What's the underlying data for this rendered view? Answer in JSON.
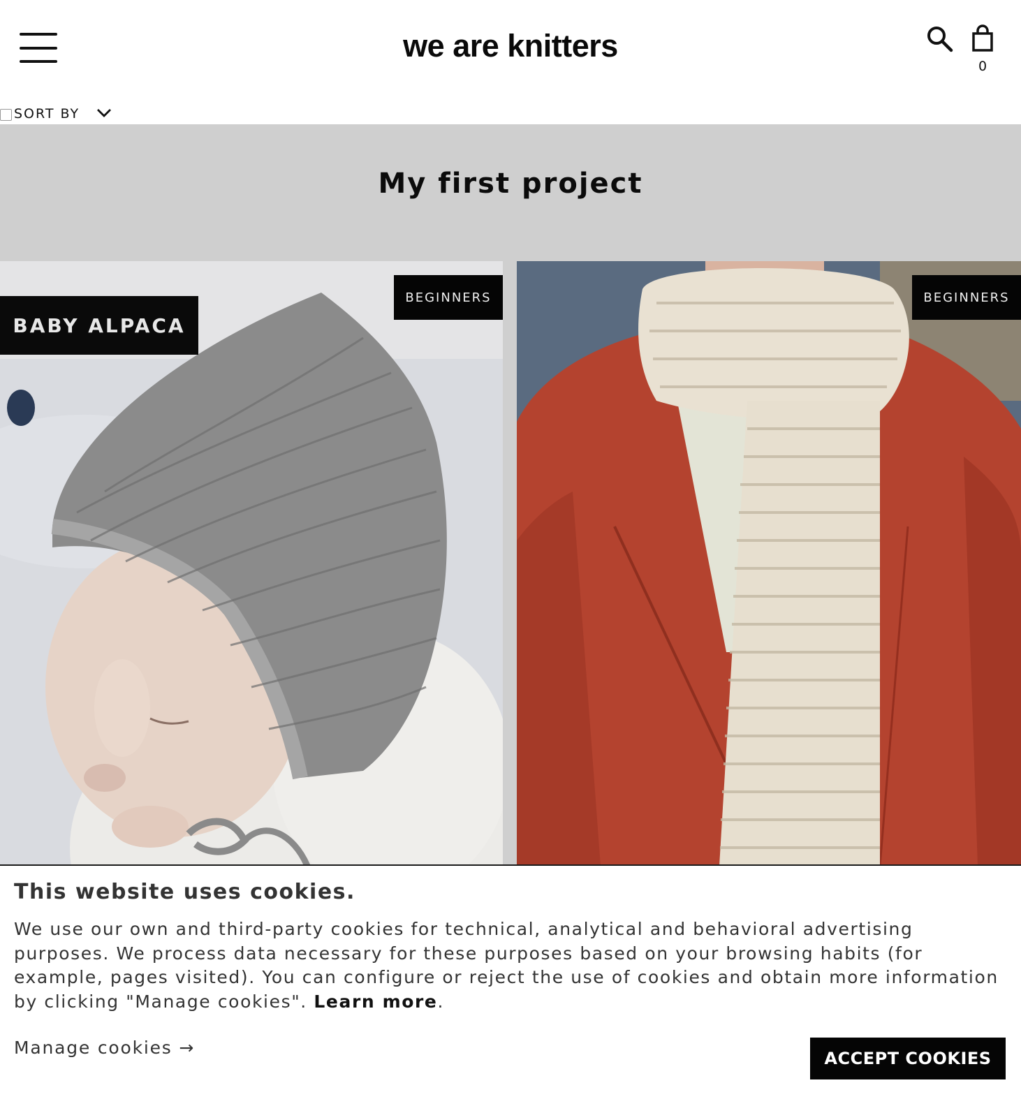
{
  "header": {
    "logo": "we are knitters",
    "cart_count": "0",
    "icons": {
      "menu": "hamburger-menu-icon",
      "search": "search-icon",
      "cart": "shopping-bag-icon"
    }
  },
  "sort": {
    "label": "SORT BY",
    "icon": "chevron-down-icon"
  },
  "category": {
    "title": "My first project"
  },
  "products": [
    {
      "tag": "BEGINNERS",
      "yarn_badge": "BABY ALPACA",
      "image": "knitted grey baby bonnet"
    },
    {
      "tag": "BEGINNERS",
      "image": "chunky cream knitted scarf on red coat"
    }
  ],
  "cookie_banner": {
    "title": "This website uses cookies.",
    "text": "We use our own and third-party cookies for technical, analytical and behavioral advertising purposes. We process data necessary for these purposes based on your browsing habits (for example, pages visited). You can configure or reject the use of cookies and obtain more information by clicking \"Manage cookies\".",
    "learn_more": "Learn more",
    "text_end": ".",
    "manage_label": "Manage cookies →",
    "accept_label": "ACCEPT COOKIES"
  },
  "colors": {
    "banner_bg": "#cfcfcf",
    "badge_bg": "#050505",
    "coat_red": "#b4432f",
    "scarf_cream": "#e9e1d2",
    "bonnet_grey": "#8a8a8a"
  }
}
